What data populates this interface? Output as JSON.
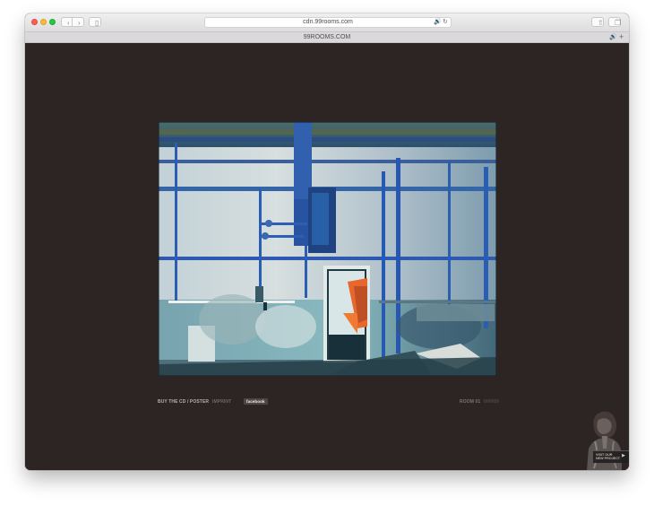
{
  "browser": {
    "address": "cdn.99rooms.com",
    "tab_title": "99ROOMS.COM",
    "icons": {
      "back": "chevron-left-icon",
      "forward": "chevron-right-icon",
      "sidebar": "sidebar-icon",
      "audio": "speaker-icon",
      "reload": "reload-icon",
      "share": "share-icon",
      "tabs": "tabs-icon",
      "new_tab": "plus-icon"
    },
    "glyphs": {
      "back": "‹",
      "forward": "›",
      "sidebar": "▯",
      "audio": "🔊",
      "reload": "↻",
      "share": "⇧",
      "tabs": "❐",
      "new_tab": "+"
    }
  },
  "page": {
    "footer": {
      "buy": "BUY THE CD / POSTER",
      "imprint": "IMPRINT",
      "facebook": "facebook",
      "room": "ROOM 01",
      "room_muted": "000000"
    },
    "promo": {
      "line1": "VISIT OUR",
      "line2": "NEW PROJECT",
      "arrow": "▶"
    }
  },
  "colors": {
    "page_background": "#2c2523",
    "window_chrome": "#dedcde",
    "accent_orange": "#e8672c",
    "pipe_blue": "#2e59b0"
  }
}
